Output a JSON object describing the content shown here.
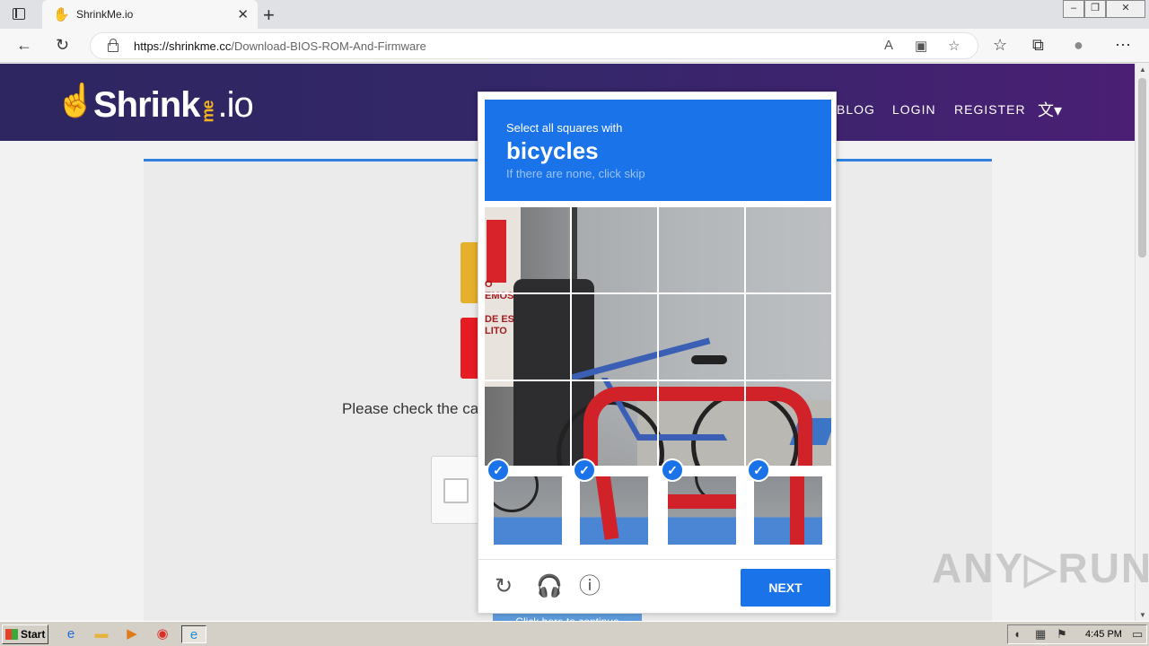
{
  "browser": {
    "tab_title": "ShrinkMe.io",
    "tab_close": "✕",
    "new_tab": "+",
    "url_host": "https://shrinkme.cc",
    "url_path": "/Download-BIOS-ROM-And-Firmware",
    "window_controls": [
      "–",
      "❐",
      "✕"
    ]
  },
  "site": {
    "logo_main": "Shrink",
    "logo_me": "me",
    "logo_io": ".io",
    "nav": [
      "BLOG",
      "LOGIN",
      "REGISTER"
    ],
    "please_text": "Please check the ca",
    "continue_label": "Click here to continue"
  },
  "captcha": {
    "prompt_line1": "Select all squares with",
    "prompt_target": "bicycles",
    "prompt_hint": "If there are none, click skip",
    "grid_text": "O\nEMOS\nDE ES\nLITO",
    "selected_count": 4,
    "next_label": "NEXT",
    "check_mark": "✓"
  },
  "watermark": "ANY▷RUN",
  "taskbar": {
    "start_label": "Start",
    "clock": "4:45 PM"
  },
  "colors": {
    "captcha_blue": "#1a73e8",
    "header_purple": "#35276a",
    "rack_red": "#d1222a"
  }
}
